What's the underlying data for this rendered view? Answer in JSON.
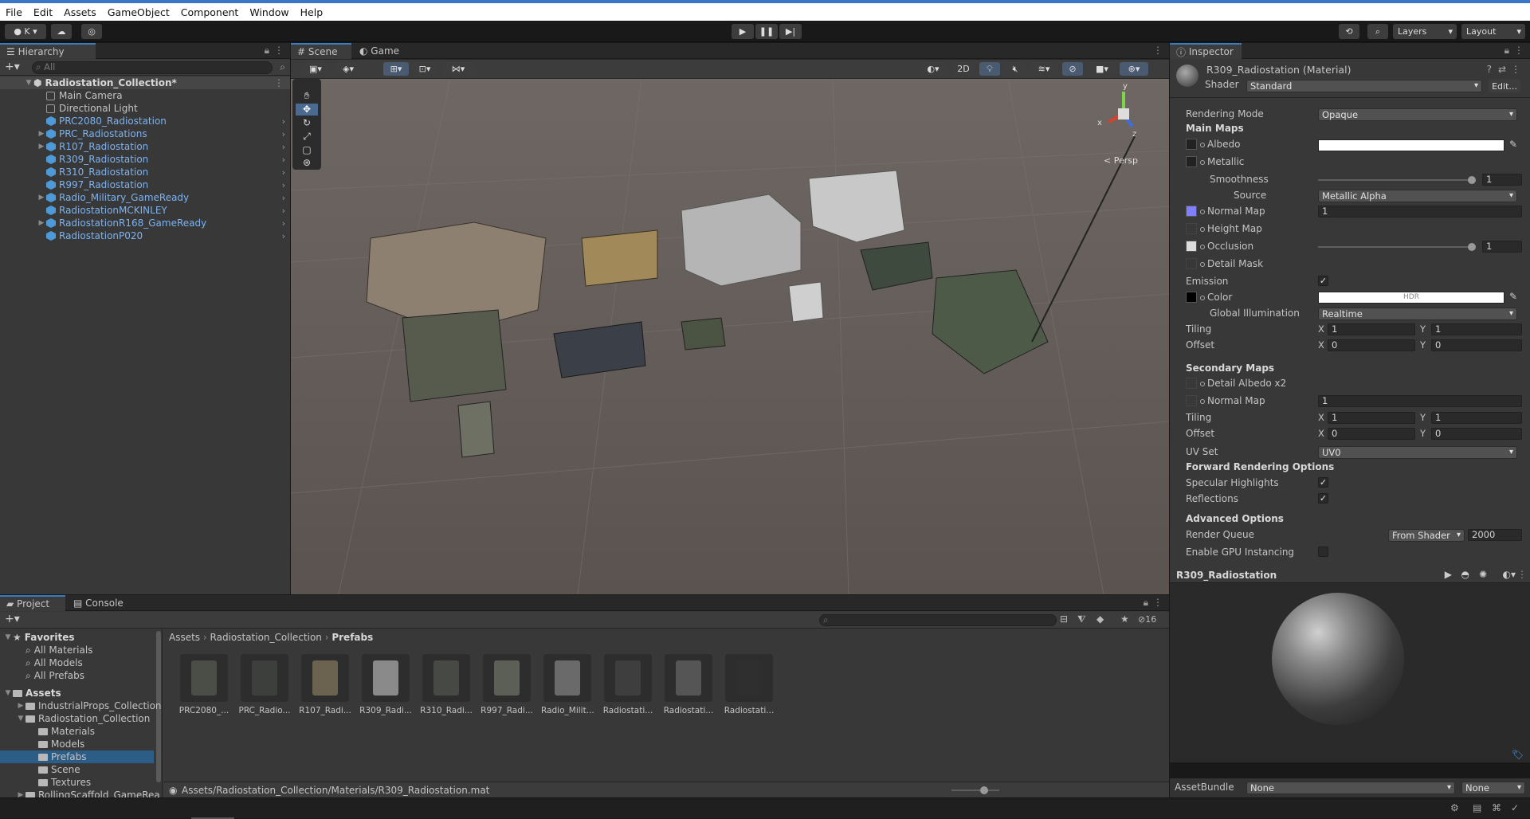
{
  "menu": [
    "File",
    "Edit",
    "Assets",
    "GameObject",
    "Component",
    "Window",
    "Help"
  ],
  "toolbar": {
    "account": "K",
    "layers": "Layers",
    "layout": "Layout"
  },
  "hierarchy": {
    "tab": "Hierarchy",
    "search_placeholder": "All",
    "scene": "Radiostation_Collection*",
    "items": [
      {
        "label": "Main Camera",
        "blue": false,
        "expand": false
      },
      {
        "label": "Directional Light",
        "blue": false,
        "expand": false
      },
      {
        "label": "PRC2080_Radiostation",
        "blue": true,
        "expand": false
      },
      {
        "label": "PRC_Radiostations",
        "blue": true,
        "expand": true
      },
      {
        "label": "R107_Radiostation",
        "blue": true,
        "expand": true
      },
      {
        "label": "R309_Radiostation",
        "blue": true,
        "expand": false
      },
      {
        "label": "R310_Radiostation",
        "blue": true,
        "expand": false
      },
      {
        "label": "R997_Radiostation",
        "blue": true,
        "expand": false
      },
      {
        "label": "Radio_Military_GameReady",
        "blue": true,
        "expand": true
      },
      {
        "label": "RadiostationMCKINLEY",
        "blue": true,
        "expand": false
      },
      {
        "label": "RadiostationR168_GameReady",
        "blue": true,
        "expand": true
      },
      {
        "label": "RadiostationP020",
        "blue": true,
        "expand": false
      }
    ]
  },
  "scene": {
    "tab_scene": "Scene",
    "tab_game": "Game",
    "mode_2d": "2D",
    "persp": "< Persp",
    "gizmo_y": "y",
    "gizmo_x": "x",
    "gizmo_z": "z"
  },
  "inspector": {
    "tab": "Inspector",
    "title": "R309_Radiostation (Material)",
    "shader_label": "Shader",
    "shader": "Standard",
    "edit": "Edit...",
    "rendering_mode_label": "Rendering Mode",
    "rendering_mode": "Opaque",
    "main_maps": "Main Maps",
    "albedo": "Albedo",
    "metallic": "Metallic",
    "smoothness": "Smoothness",
    "smoothness_value": "1",
    "source": "Source",
    "source_value": "Metallic Alpha",
    "normal_map": "Normal Map",
    "normal_value": "1",
    "height_map": "Height Map",
    "occlusion": "Occlusion",
    "occlusion_value": "1",
    "detail_mask": "Detail Mask",
    "emission": "Emission",
    "color": "Color",
    "hdr": "HDR",
    "gi_label": "Global Illumination",
    "gi": "Realtime",
    "tiling": "Tiling",
    "offset": "Offset",
    "x": "X",
    "y": "Y",
    "tiling_x": "1",
    "tiling_y": "1",
    "offset_x": "0",
    "offset_y": "0",
    "secondary_maps": "Secondary Maps",
    "detail_albedo": "Detail Albedo x2",
    "normal_map2": "Normal Map",
    "normal_value2": "1",
    "tiling2_x": "1",
    "tiling2_y": "1",
    "offset2_x": "0",
    "offset2_y": "0",
    "uv_set": "UV Set",
    "uv_value": "UV0",
    "forward": "Forward Rendering Options",
    "specular": "Specular Highlights",
    "reflections": "Reflections",
    "advanced": "Advanced Options",
    "render_queue": "Render Queue",
    "render_queue_mode": "From Shader",
    "render_queue_value": "2000",
    "gpu_instancing": "Enable GPU Instancing",
    "preview_title": "R309_Radiostation",
    "asset_bundle": "AssetBundle",
    "asset_bundle_value": "None",
    "asset_bundle_variant": "None"
  },
  "project": {
    "tab_project": "Project",
    "tab_console": "Console",
    "favorites": "Favorites",
    "fav_items": [
      "All Materials",
      "All Models",
      "All Prefabs"
    ],
    "assets": "Assets",
    "tree": [
      {
        "label": "IndustrialProps_Collection",
        "indent": 1,
        "expand": true
      },
      {
        "label": "Radiostation_Collection",
        "indent": 1,
        "expand": true,
        "open": true
      },
      {
        "label": "Materials",
        "indent": 2
      },
      {
        "label": "Models",
        "indent": 2
      },
      {
        "label": "Prefabs",
        "indent": 2,
        "selected": true
      },
      {
        "label": "Scene",
        "indent": 2
      },
      {
        "label": "Textures",
        "indent": 2
      },
      {
        "label": "RollingScaffold_GameRea",
        "indent": 1,
        "expand": true
      }
    ],
    "breadcrumb": [
      "Assets",
      "Radiostation_Collection",
      "Prefabs"
    ],
    "hidden_count": "16",
    "thumbs": [
      "PRC2080_...",
      "PRC_Radio...",
      "R107_Radi...",
      "R309_Radi...",
      "R310_Radi...",
      "R997_Radi...",
      "Radio_Milit...",
      "Radiostati...",
      "Radiostati...",
      "Radiostati..."
    ],
    "path": "Assets/Radiostation_Collection/Materials/R309_Radiostation.mat"
  },
  "colors": {
    "accent": "#3a79bb",
    "link": "#7bb2f0",
    "scene_bg": "#5a5350"
  }
}
